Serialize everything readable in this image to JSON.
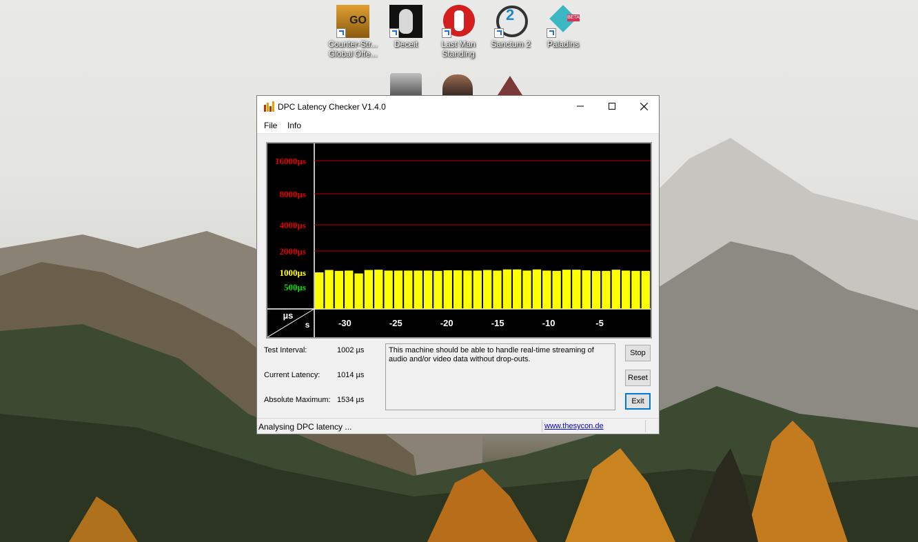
{
  "desktop": {
    "icons": [
      {
        "label_line1": "Counter-Str...",
        "label_line2": "Global Offe...",
        "icon": "csgo-icon"
      },
      {
        "label_line1": "Deceit",
        "label_line2": "",
        "icon": "deceit-icon"
      },
      {
        "label_line1": "Last Man",
        "label_line2": "Standing",
        "icon": "last-man-standing-icon"
      },
      {
        "label_line1": "Sanctum 2",
        "label_line2": "",
        "icon": "sanctum2-icon"
      },
      {
        "label_line1": "Paladins",
        "label_line2": "",
        "icon": "paladins-icon"
      }
    ]
  },
  "window": {
    "title": "DPC Latency Checker V1.4.0",
    "menu": {
      "file": "File",
      "info": "Info"
    },
    "info": {
      "test_interval_label": "Test Interval:",
      "test_interval_value": "1002 µs",
      "current_latency_label": "Current Latency:",
      "current_latency_value": "1014 µs",
      "absolute_max_label": "Absolute Maximum:",
      "absolute_max_value": "1534 µs"
    },
    "message": "This machine should be able to handle real-time streaming of audio and/or video data without drop-outs.",
    "buttons": {
      "stop": "Stop",
      "reset": "Reset",
      "exit": "Exit"
    },
    "status": "Analysing DPC latency ...",
    "link": "www.thesycon.de"
  },
  "chart_data": {
    "type": "bar",
    "y_labels": [
      {
        "text": "16000µs",
        "color": "#e00000"
      },
      {
        "text": "8000µs",
        "color": "#e00000"
      },
      {
        "text": "4000µs",
        "color": "#e00000"
      },
      {
        "text": "2000µs",
        "color": "#e00000"
      },
      {
        "text": "1000µs",
        "color": "#ffff00"
      },
      {
        "text": "500µs",
        "color": "#00e000"
      }
    ],
    "x_ticks": [
      "-30",
      "-25",
      "-20",
      "-15",
      "-10",
      "-5"
    ],
    "x_tick_values": [
      -30,
      -25,
      -20,
      -15,
      -10,
      -5
    ],
    "corner_labels": {
      "y_unit": "µs",
      "x_unit": "s"
    },
    "bar_color": "#ffff00",
    "values": [
      1000,
      1080,
      1050,
      1060,
      950,
      1080,
      1090,
      1060,
      1060,
      1060,
      1060,
      1060,
      1050,
      1070,
      1070,
      1060,
      1060,
      1080,
      1060,
      1100,
      1100,
      1060,
      1100,
      1060,
      1050,
      1090,
      1090,
      1070,
      1050,
      1050,
      1090,
      1060,
      1050,
      1050
    ],
    "x_range": [
      -33,
      0
    ]
  }
}
